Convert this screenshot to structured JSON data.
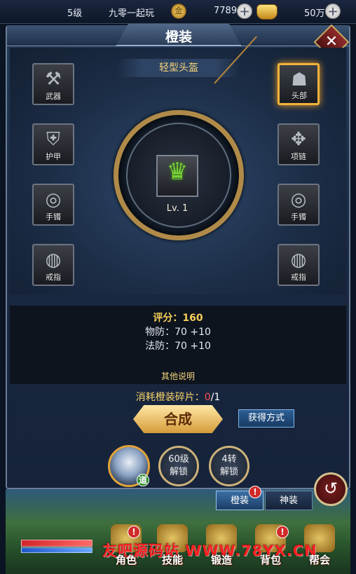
{
  "topbar": {
    "level": "5级",
    "player_name": "九零一起玩",
    "coin_glyph": "金",
    "coins": "7789",
    "ingots": "50万",
    "plus": "+"
  },
  "panel": {
    "title": "橙装",
    "close": "✕",
    "equipped_name": "轻型头盔",
    "item_level": "Lv. 1"
  },
  "slots": {
    "left": [
      {
        "label": "武器",
        "glyph": "⚒"
      },
      {
        "label": "护甲",
        "glyph": "⛨"
      },
      {
        "label": "手镯",
        "glyph": "◎"
      },
      {
        "label": "戒指",
        "glyph": "◍"
      }
    ],
    "right": [
      {
        "label": "头部",
        "glyph": "☗"
      },
      {
        "label": "项链",
        "glyph": "✥"
      },
      {
        "label": "手镯",
        "glyph": "◎"
      },
      {
        "label": "戒指",
        "glyph": "◍"
      }
    ]
  },
  "stats": {
    "score": "评分：160",
    "phys_def": "物防：70  +10",
    "mag_def": "法防：70  +10",
    "other": "其他说明"
  },
  "synth": {
    "consume_label": "消耗橙装碎片：",
    "have": "0",
    "need": "/1",
    "synth_button": "合成",
    "obtain_button": "获得方式"
  },
  "unlocks": {
    "avatar_badge": "道",
    "lv60": [
      "60级",
      "解锁"
    ],
    "turn4": [
      "4转",
      "解锁"
    ]
  },
  "tabs": {
    "orange": "橙装",
    "divine": "神装"
  },
  "return_icon": "↺",
  "nav": [
    "角色",
    "技能",
    "锻造",
    "背包",
    "帮会"
  ],
  "badge": "!",
  "watermark": "友吧源码站 WWW.78YX.CN"
}
